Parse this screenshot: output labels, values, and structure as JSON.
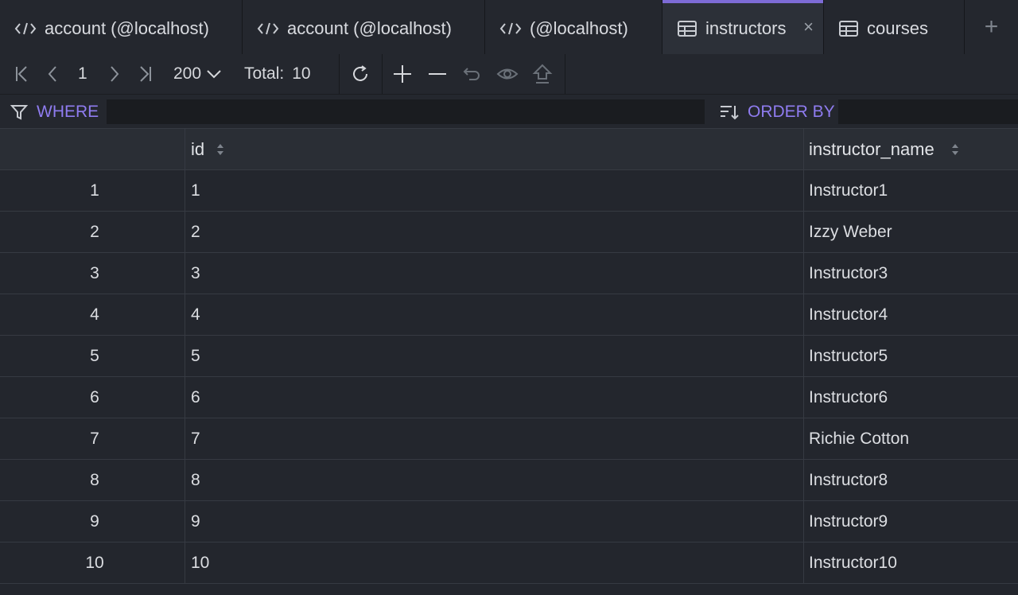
{
  "tabs": [
    {
      "label": "account (@localhost)",
      "icon": "code-icon",
      "active": false,
      "closable": false
    },
    {
      "label": "account (@localhost)",
      "icon": "code-icon",
      "active": false,
      "closable": false
    },
    {
      "label": "(@localhost)",
      "icon": "code-icon",
      "active": true,
      "closable": false
    },
    {
      "label": "instructors",
      "icon": "table-icon",
      "active": true,
      "closable": true
    },
    {
      "label": "courses",
      "icon": "table-icon",
      "active": false,
      "closable": false
    }
  ],
  "tab_close_glyph": "×",
  "tab_add_glyph": "+",
  "toolbar": {
    "page": "1",
    "page_size": "200",
    "total_label": "Total:",
    "total_value": "10"
  },
  "filter": {
    "where_label": "WHERE",
    "where_value": "",
    "order_label": "ORDER BY",
    "order_value": ""
  },
  "columns": [
    "",
    "id",
    "instructor_name"
  ],
  "rows": [
    {
      "n": "1",
      "id": "1",
      "name": "Instructor1"
    },
    {
      "n": "2",
      "id": "2",
      "name": "Izzy Weber"
    },
    {
      "n": "3",
      "id": "3",
      "name": "Instructor3"
    },
    {
      "n": "4",
      "id": "4",
      "name": "Instructor4"
    },
    {
      "n": "5",
      "id": "5",
      "name": "Instructor5"
    },
    {
      "n": "6",
      "id": "6",
      "name": "Instructor6"
    },
    {
      "n": "7",
      "id": "7",
      "name": "Richie Cotton"
    },
    {
      "n": "8",
      "id": "8",
      "name": "Instructor8"
    },
    {
      "n": "9",
      "id": "9",
      "name": "Instructor9"
    },
    {
      "n": "10",
      "id": "10",
      "name": "Instructor10"
    }
  ],
  "colors": {
    "accent": "#7d6bd6",
    "label_purple": "#8f7cf0",
    "background": "#23262d"
  }
}
